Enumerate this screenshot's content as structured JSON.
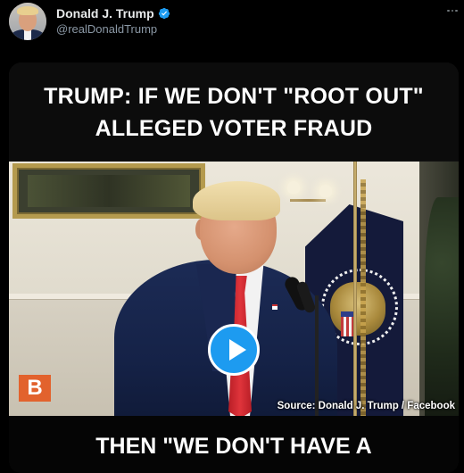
{
  "tweet": {
    "display_name": "Donald J. Trump",
    "handle": "@realDonaldTrump",
    "verified": true,
    "more_icon": "more-horizontal-icon"
  },
  "video": {
    "headline_line1": "TRUMP: IF WE DON'T \"ROOT OUT\"",
    "headline_line2": "ALLEGED VOTER FRAUD",
    "headline_bottom": "THEN \"WE DON'T HAVE A",
    "source_credit": "Source: Donald J. Trump / Facebook",
    "channel_logo_letter": "B",
    "play_icon": "play-icon",
    "colors": {
      "play_button": "#1d9bf0",
      "logo_bg": "#e2622d"
    }
  }
}
